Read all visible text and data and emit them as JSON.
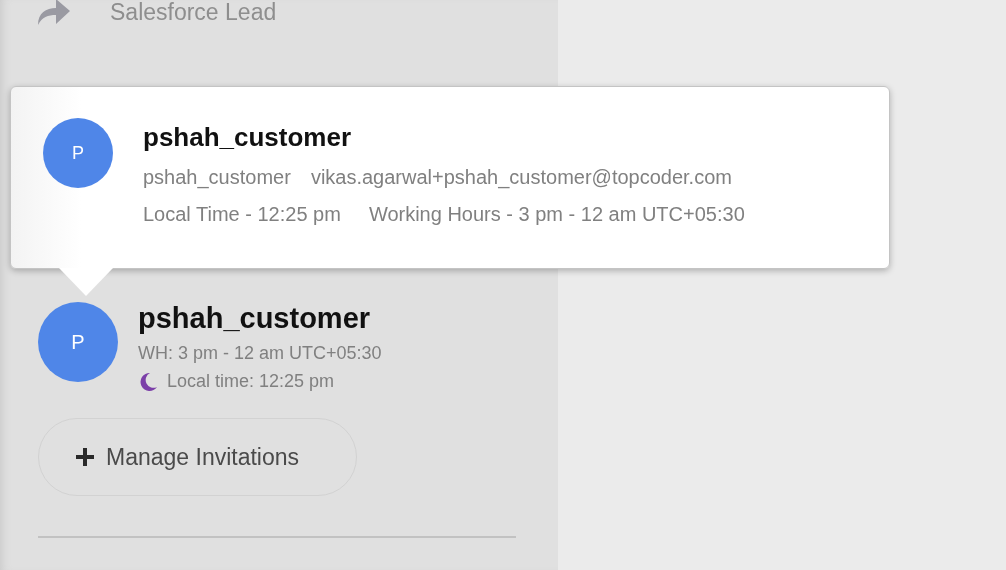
{
  "sidebar": {
    "link": {
      "label": "Salesforce Lead"
    },
    "member": {
      "initial": "P",
      "name": "pshah_customer",
      "working_hours": "WH: 3 pm - 12 am UTC+05:30",
      "local_time": "Local time: 12:25 pm"
    },
    "button": {
      "label": "Manage Invitations"
    }
  },
  "popover": {
    "initial": "P",
    "name": "pshah_customer",
    "handle": "pshah_customer",
    "email": "vikas.agarwal+pshah_customer@topcoder.com",
    "local_time": "Local Time - 12:25 pm",
    "working_hours": "Working Hours - 3 pm - 12 am UTC+05:30"
  }
}
